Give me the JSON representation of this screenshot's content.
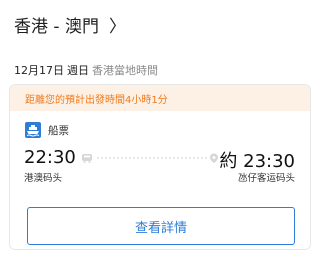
{
  "header": {
    "route_title": "香港 - 澳門",
    "chevron_glyph": "〉"
  },
  "schedule": {
    "date": "12月17日",
    "weekday": "週日",
    "timezone_note": "香港當地時間"
  },
  "card": {
    "countdown_banner": "距離您的預計出發時間4小時1分",
    "transport_type": "船票",
    "departure_time": "22:30",
    "arrival_time": "約 23:30",
    "departure_port": "港澳码头",
    "arrival_port": "氹仔客运码头",
    "details_button": "查看詳情"
  },
  "colors": {
    "accent_blue": "#2f7dd6",
    "banner_bg": "#fdf0e4",
    "banner_text": "#f07b1f"
  },
  "icons": [
    "ferry-icon",
    "train-icon",
    "location-pin-icon",
    "chevron-right-icon"
  ]
}
